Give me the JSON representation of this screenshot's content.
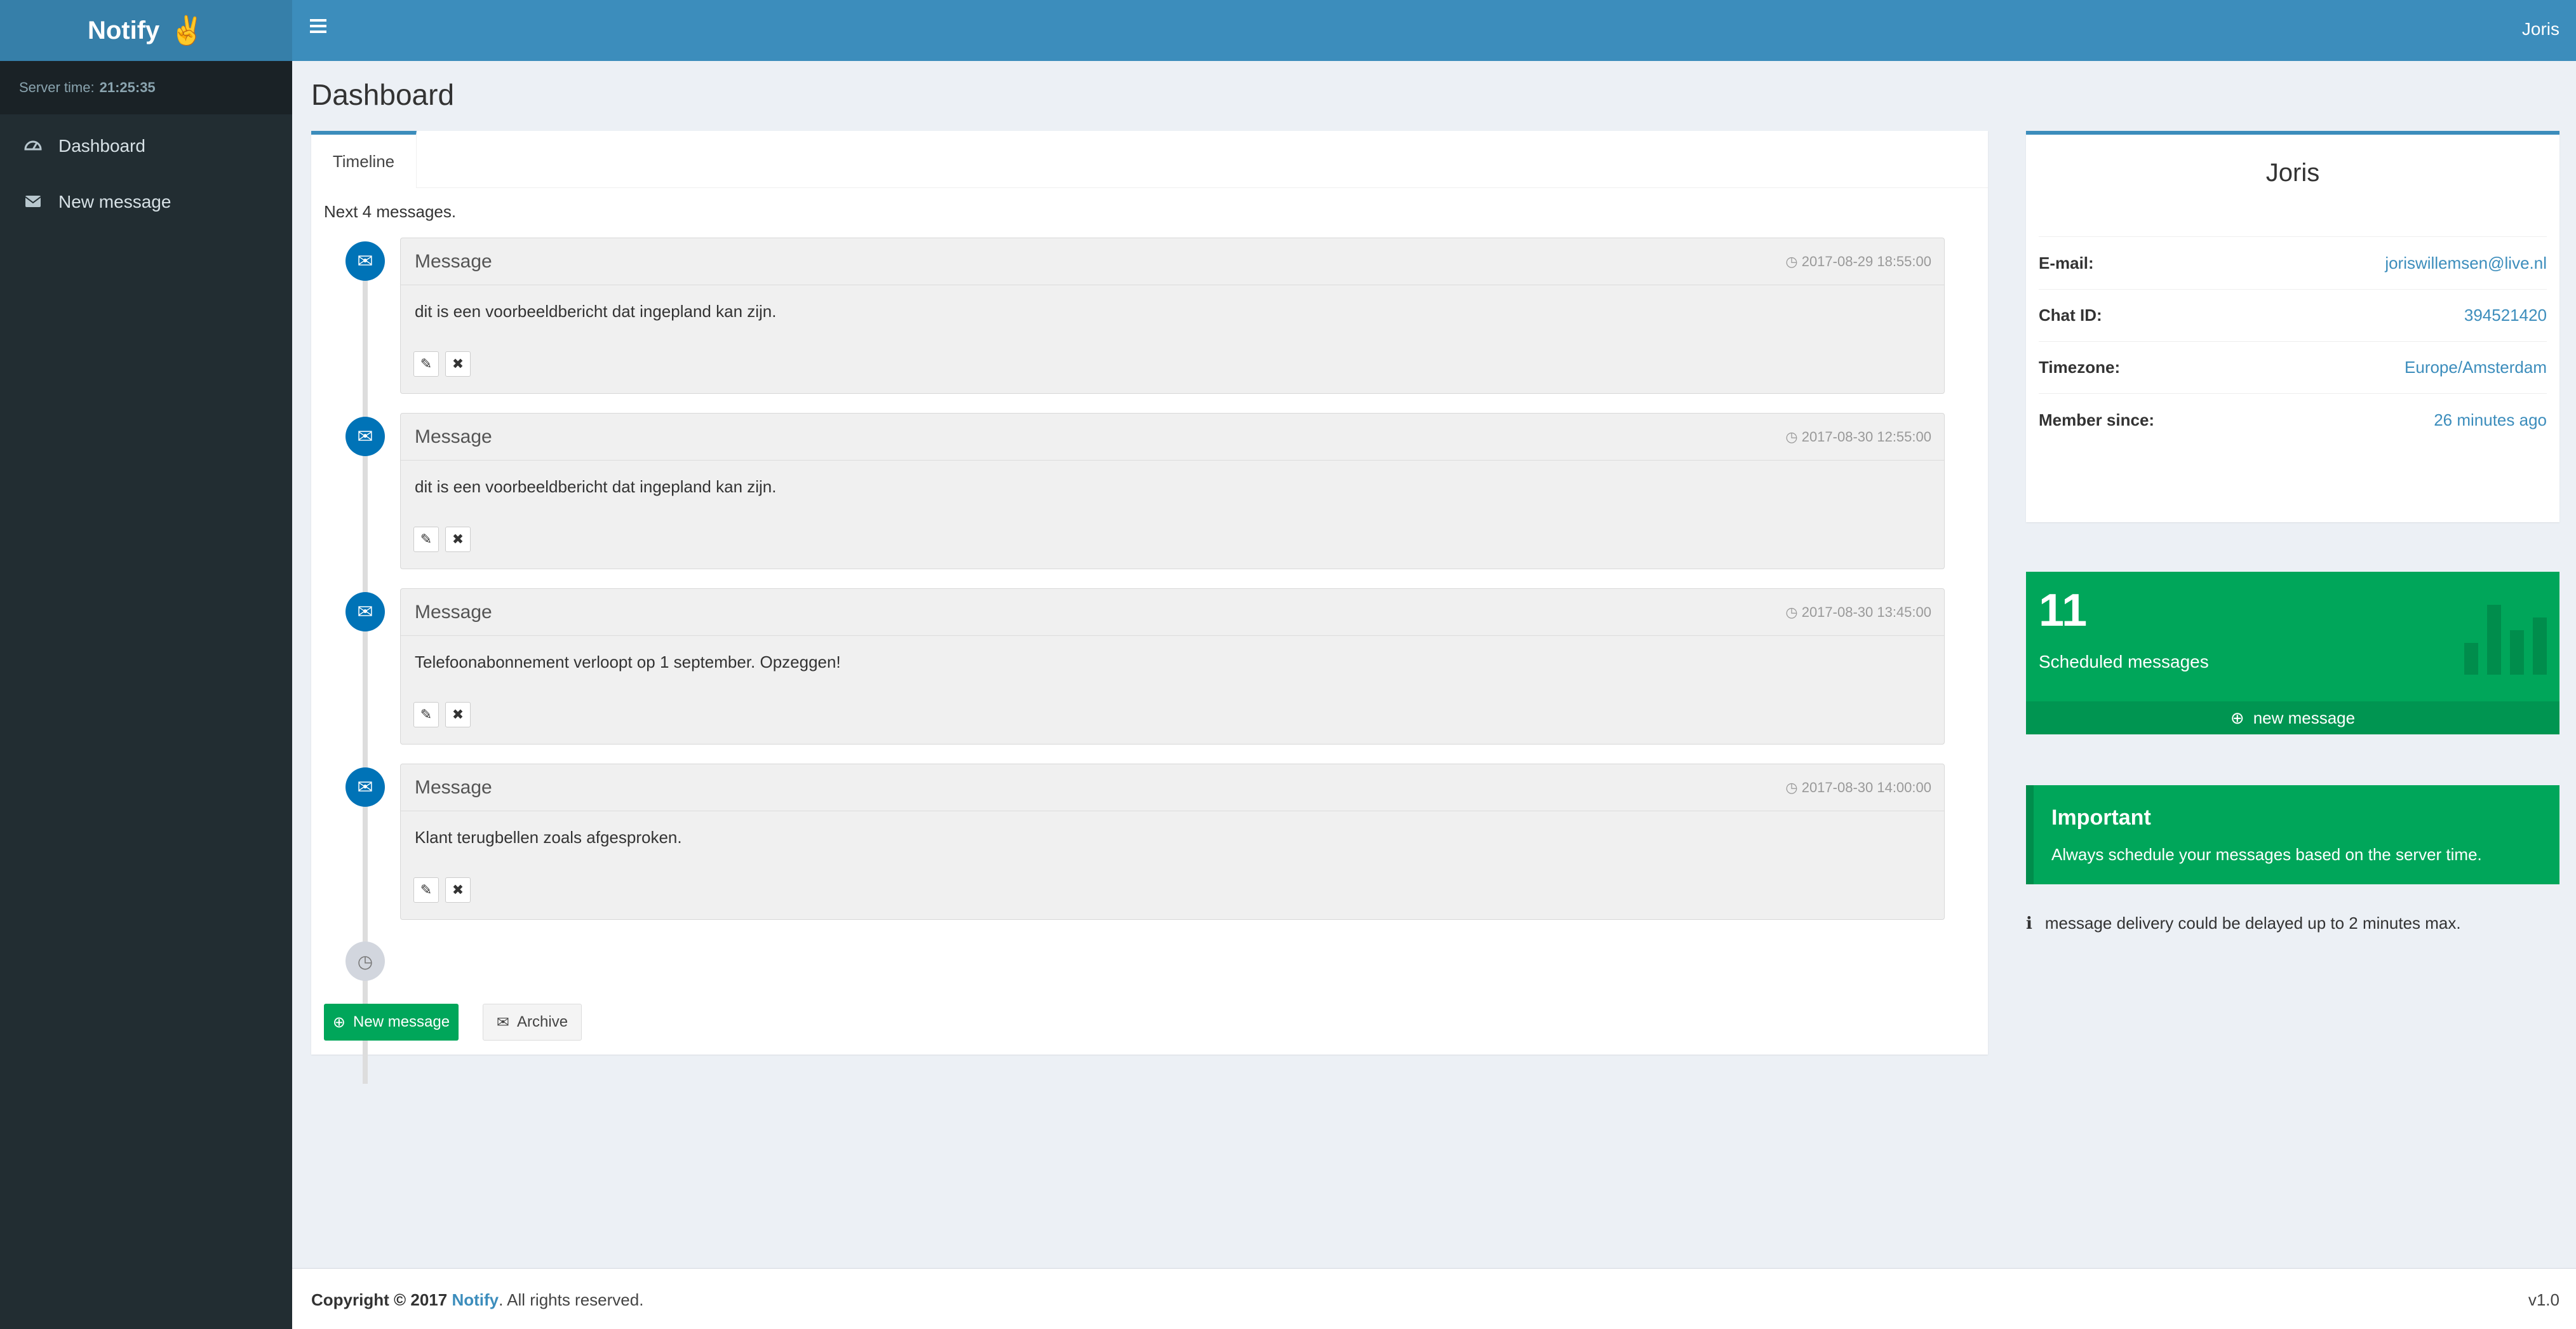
{
  "app": {
    "name": "Notify"
  },
  "sidebar": {
    "server_time_label": "Server time:",
    "server_time_value": "21:25:35",
    "items": [
      {
        "label": "Dashboard",
        "icon": "dashboard-icon"
      },
      {
        "label": "New message",
        "icon": "envelope-icon"
      }
    ]
  },
  "header": {
    "user": "Joris"
  },
  "page": {
    "title": "Dashboard"
  },
  "timeline": {
    "tab": "Timeline",
    "summary": "Next 4 messages.",
    "items": [
      {
        "title": "Message",
        "time": "2017-08-29 18:55:00",
        "body": "dit is een voorbeeldbericht dat ingepland kan zijn."
      },
      {
        "title": "Message",
        "time": "2017-08-30 12:55:00",
        "body": "dit is een voorbeeldbericht dat ingepland kan zijn."
      },
      {
        "title": "Message",
        "time": "2017-08-30 13:45:00",
        "body": "Telefoonabonnement verloopt op 1 september. Opzeggen!"
      },
      {
        "title": "Message",
        "time": "2017-08-30 14:00:00",
        "body": "Klant terugbellen zoals afgesproken."
      }
    ],
    "new_button": "New message",
    "archive_button": "Archive"
  },
  "profile": {
    "name": "Joris",
    "rows": [
      {
        "key": "E-mail:",
        "value": "joriswillemsen@live.nl"
      },
      {
        "key": "Chat ID:",
        "value": "394521420"
      },
      {
        "key": "Timezone:",
        "value": "Europe/Amsterdam"
      },
      {
        "key": "Member since:",
        "value": "26 minutes ago"
      }
    ]
  },
  "stats": {
    "count": "11",
    "label": "Scheduled messages",
    "footer_link": "new message"
  },
  "callout": {
    "title": "Important",
    "text": "Always schedule your messages based on the server time."
  },
  "note": "message delivery could be delayed up to 2 minutes max.",
  "footer": {
    "copyright": "Copyright © 2017",
    "brand": "Notify",
    "rights": ". All rights reserved.",
    "version": "v1.0"
  },
  "colors": {
    "header": "#3c8dbc",
    "sidebar": "#222d32",
    "success": "#00a65a",
    "timeline_icon": "#0073b7"
  }
}
